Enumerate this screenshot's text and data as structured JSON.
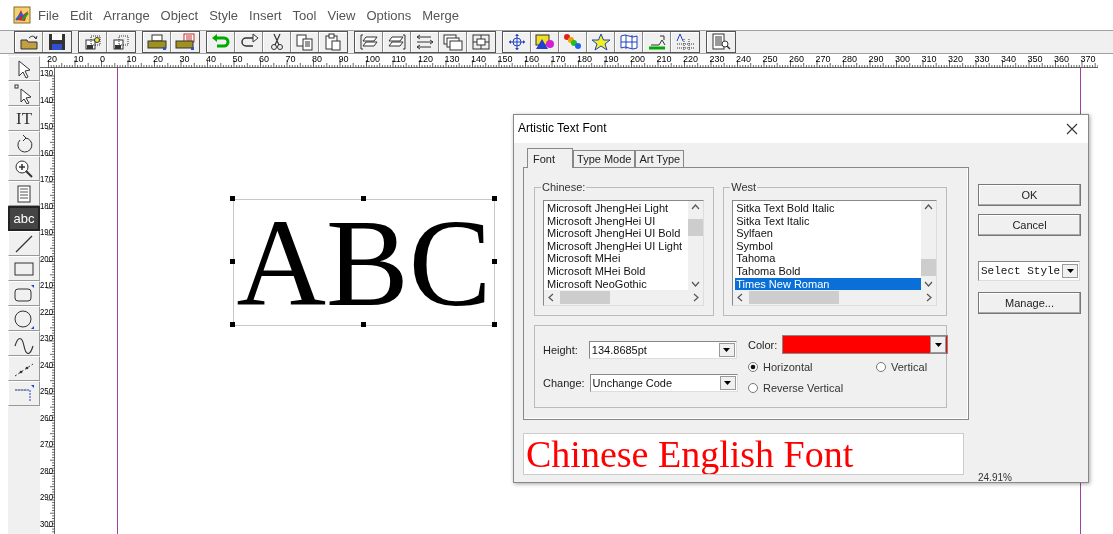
{
  "menu": [
    "File",
    "Edit",
    "Arrange",
    "Object",
    "Style",
    "Insert",
    "Tool",
    "View",
    "Options",
    "Merge"
  ],
  "tools": [
    {
      "kind": "pointer",
      "selected": false
    },
    {
      "kind": "node",
      "selected": false
    },
    {
      "kind": "text",
      "label": "IT",
      "selected": false
    },
    {
      "kind": "rotate",
      "selected": false
    },
    {
      "kind": "zoom",
      "selected": false
    },
    {
      "kind": "page",
      "selected": false
    },
    {
      "kind": "textbox",
      "label": "abc",
      "selected": true
    },
    {
      "kind": "line",
      "selected": false
    },
    {
      "kind": "rect",
      "selected": false
    },
    {
      "kind": "roundrect",
      "selected": false
    },
    {
      "kind": "ellipse",
      "selected": false
    },
    {
      "kind": "curve",
      "selected": false
    },
    {
      "kind": "dotted",
      "selected": false
    },
    {
      "kind": "corner",
      "selected": false
    }
  ],
  "rulers": {
    "horizontal": [
      "20",
      "10",
      "0",
      "10",
      "20",
      "30",
      "40",
      "50",
      "60",
      "70",
      "80",
      "90",
      "100",
      "110",
      "120",
      "130",
      "140",
      "150",
      "160",
      "170",
      "180",
      "190",
      "200",
      "210",
      "220",
      "230",
      "240",
      "250",
      "260",
      "270",
      "280",
      "290",
      "300",
      "310",
      "320",
      "330",
      "340",
      "350",
      "360",
      "370"
    ],
    "vertical": [
      "130",
      "140",
      "150",
      "160",
      "170",
      "180",
      "190",
      "200",
      "210",
      "220",
      "230",
      "240",
      "250",
      "260",
      "270",
      "280",
      "290",
      "300"
    ]
  },
  "canvas": {
    "text": "ABC",
    "selected": true
  },
  "dialog": {
    "title": "Artistic Text Font",
    "tabs": [
      {
        "label": "Font",
        "selected": true
      },
      {
        "label": "Type Mode",
        "selected": false
      },
      {
        "label": "Art Type",
        "selected": false
      }
    ],
    "chinese": {
      "label": "Chinese:",
      "items": [
        {
          "name": "Microsoft JhengHei Light",
          "selected": false
        },
        {
          "name": "Microsoft JhengHei UI",
          "selected": false
        },
        {
          "name": "Microsoft JhengHei UI Bold",
          "selected": false
        },
        {
          "name": "Microsoft JhengHei UI Light",
          "selected": false
        },
        {
          "name": "Microsoft MHei",
          "selected": false
        },
        {
          "name": "Microsoft MHei Bold",
          "selected": false
        },
        {
          "name": "Microsoft NeoGothic",
          "selected": false
        }
      ]
    },
    "west": {
      "label": "West",
      "items": [
        {
          "name": "Sitka Text Bold Italic",
          "selected": false
        },
        {
          "name": "Sitka Text Italic",
          "selected": false
        },
        {
          "name": "Sylfaen",
          "selected": false
        },
        {
          "name": "Symbol",
          "selected": false
        },
        {
          "name": "Tahoma",
          "selected": false
        },
        {
          "name": "Tahoma Bold",
          "selected": false
        },
        {
          "name": "Times New Roman",
          "selected": true
        }
      ]
    },
    "height": {
      "label": "Height:",
      "value": "134.8685pt"
    },
    "change": {
      "label": "Change:",
      "value": "Unchange Code"
    },
    "color": {
      "label": "Color:",
      "color": "#ff0000"
    },
    "orientation": [
      {
        "label": "Horizontal",
        "selected": true
      },
      {
        "label": "Vertical",
        "selected": false
      },
      {
        "label": "Reverse Vertical",
        "selected": false
      }
    ],
    "preview": {
      "text": "Chinese English Font",
      "zoom": "24.91%"
    },
    "buttons": [
      "OK",
      "Cancel"
    ],
    "style_select": "Select Style",
    "manage": "Manage..."
  }
}
